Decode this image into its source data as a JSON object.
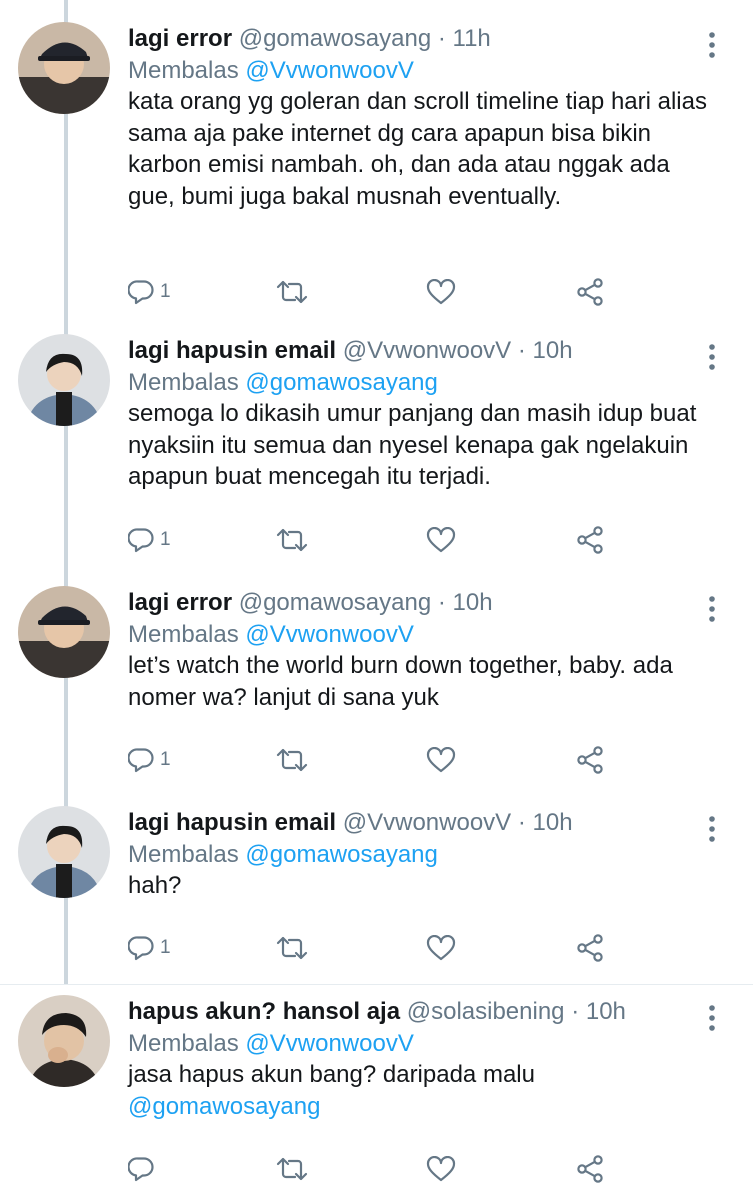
{
  "reply_prefix": "Membalas",
  "tweets": [
    {
      "name": "lagi error",
      "handle": "@gomawosayang",
      "time": "· 11h",
      "reply_to": "@VvwonwoovV",
      "text": "kata orang yg goleran dan scroll timeline tiap hari alias sama aja pake internet dg cara apapun bisa bikin karbon emisi nambah. oh, dan ada atau nggak ada gue, bumi juga bakal musnah eventually.",
      "reply_count": "1"
    },
    {
      "name": "lagi hapusin email",
      "handle": "@VvwonwoovV",
      "time": "· 10h",
      "reply_to": "@gomawosayang",
      "text": "semoga lo dikasih umur panjang dan masih idup buat nyaksiin itu semua dan nyesel kenapa gak ngelakuin apapun buat mencegah itu terjadi.",
      "reply_count": "1"
    },
    {
      "name": "lagi error",
      "handle": "@gomawosayang",
      "time": "· 10h",
      "reply_to": "@VvwonwoovV",
      "text": "let’s watch the world burn down together, baby. ada nomer wa? lanjut di sana yuk",
      "reply_count": "1"
    },
    {
      "name": "lagi hapusin email",
      "handle": "@VvwonwoovV",
      "time": "· 10h",
      "reply_to": "@gomawosayang",
      "text": "hah?",
      "reply_count": "1"
    },
    {
      "name": "hapus akun? hansol aja",
      "handle": "@solasibening",
      "time": "· 10h",
      "reply_to": "@VvwonwoovV",
      "text": "jasa hapus akun bang? daripada malu",
      "text_mention": "@gomawosayang",
      "reply_count": ""
    }
  ],
  "icons": {
    "reply": "reply-icon",
    "retweet": "retweet-icon",
    "like": "heart-icon",
    "share": "share-icon",
    "more": "more-vertical-icon"
  },
  "colors": {
    "link": "#1da1f2",
    "secondary": "#657786",
    "thread_line": "#ccd6dd"
  }
}
